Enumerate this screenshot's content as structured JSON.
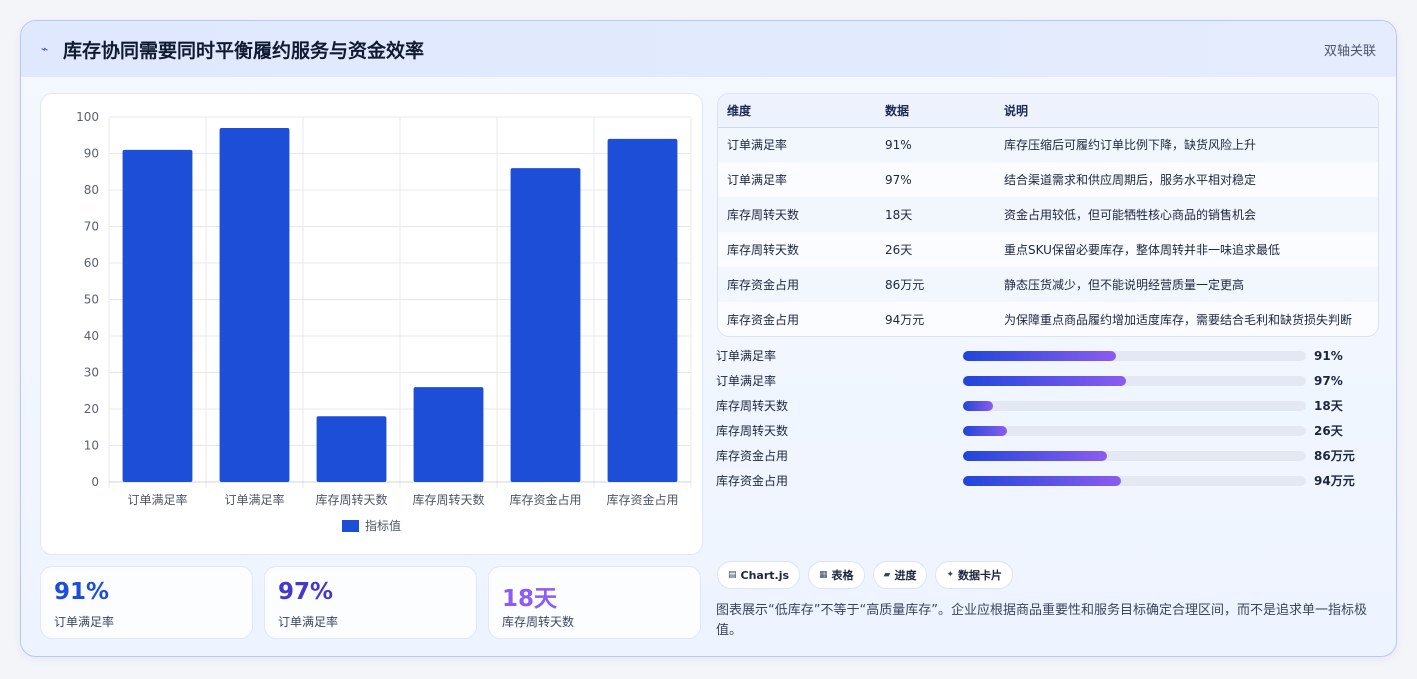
{
  "header": {
    "title": "库存协同需要同时平衡履约服务与资金效率",
    "tag": "双轴关联"
  },
  "chart_data": {
    "type": "bar",
    "categories": [
      "订单满足率",
      "订单满足率",
      "库存周转天数",
      "库存周转天数",
      "库存资金占用",
      "库存资金占用"
    ],
    "series": [
      {
        "name": "指标值",
        "values": [
          91,
          97,
          18,
          26,
          86,
          94
        ]
      }
    ],
    "ylim": [
      0,
      100
    ],
    "yticks": [
      0,
      10,
      20,
      30,
      40,
      50,
      60,
      70,
      80,
      90,
      100
    ],
    "grid": true,
    "legend": "bottom",
    "bar_color": "#1d4ed8"
  },
  "kpis": [
    {
      "value": "91%",
      "label": "订单满足率",
      "color": "#1d4ed8"
    },
    {
      "value": "97%",
      "label": "订单满足率",
      "color": "#4338ca"
    },
    {
      "value": "18天",
      "label": "库存周转天数",
      "color": "#8b5cf6"
    }
  ],
  "table": {
    "headers": [
      "维度",
      "数据",
      "说明"
    ],
    "rows": [
      [
        "订单满足率",
        "91%",
        "库存压缩后可履约订单比例下降，缺货风险上升"
      ],
      [
        "订单满足率",
        "97%",
        "结合渠道需求和供应周期后，服务水平相对稳定"
      ],
      [
        "库存周转天数",
        "18天",
        "资金占用较低，但可能牺牲核心商品的销售机会"
      ],
      [
        "库存周转天数",
        "26天",
        "重点SKU保留必要库存，整体周转并非一味追求最低"
      ],
      [
        "库存资金占用",
        "86万元",
        "静态压货减少，但不能说明经营质量一定更高"
      ],
      [
        "库存资金占用",
        "94万元",
        "为保障重点商品履约增加适度库存，需要结合毛利和缺货损失判断"
      ]
    ]
  },
  "progress": [
    {
      "label": "订单满足率",
      "value": "91%",
      "fraction": 0.445
    },
    {
      "label": "订单满足率",
      "value": "97%",
      "fraction": 0.475
    },
    {
      "label": "库存周转天数",
      "value": "18天",
      "fraction": 0.088
    },
    {
      "label": "库存周转天数",
      "value": "26天",
      "fraction": 0.128
    },
    {
      "label": "库存资金占用",
      "value": "86万元",
      "fraction": 0.42
    },
    {
      "label": "库存资金占用",
      "value": "94万元",
      "fraction": 0.46
    }
  ],
  "chips": [
    {
      "icon": "chart-icon",
      "glyph": "▤",
      "label": "Chart.js"
    },
    {
      "icon": "table-icon",
      "glyph": "▦",
      "label": "表格"
    },
    {
      "icon": "progress-icon",
      "glyph": "▰",
      "label": "进度"
    },
    {
      "icon": "sparkle-icon",
      "glyph": "✦",
      "label": "数据卡片"
    }
  ],
  "note": "图表展示“低库存”不等于“高质量库存”。企业应根据商品重要性和服务目标确定合理区间，而不是追求单一指标极值。"
}
